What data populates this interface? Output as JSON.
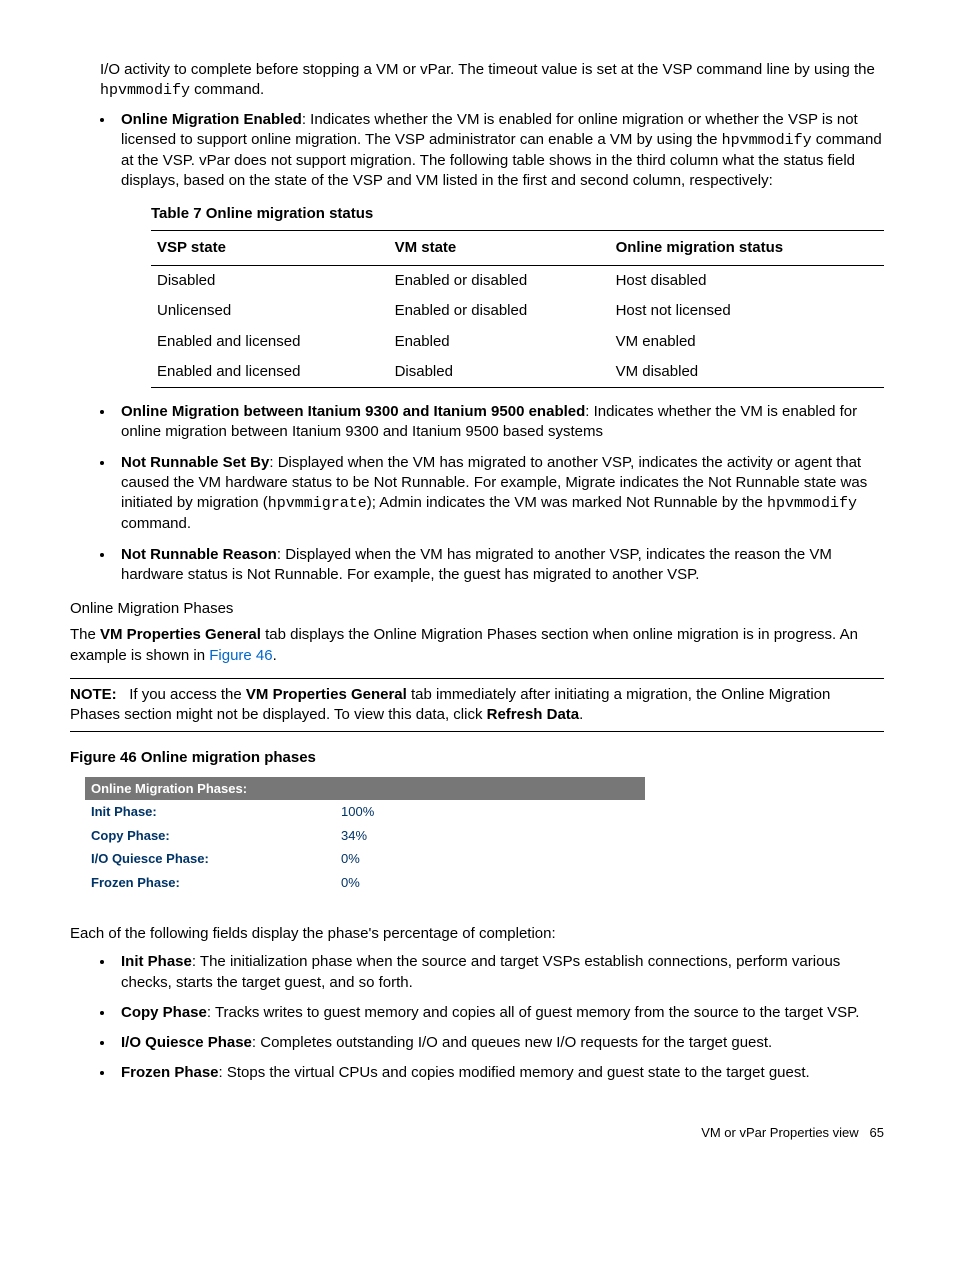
{
  "intro_para": {
    "line1_a": "I/O activity to complete before stopping a VM or vPar. The timeout value is set at the VSP command line by using the ",
    "cmd1": "hpvmmodify",
    "line1_b": " command."
  },
  "bullet_online_mig_enabled": {
    "label": "Online Migration Enabled",
    "text_a": ": Indicates whether the VM is enabled for online migration or whether the VSP is not licensed to support online migration. The VSP administrator can enable a VM by using the ",
    "cmd": "hpvmmodify",
    "text_b": " command at the VSP. vPar does not support migration. The following table shows in the third column what the status field displays, based on the state of the VSP and VM listed in the first and second column, respectively:"
  },
  "table7": {
    "title": "Table 7 Online migration status",
    "headers": [
      "VSP state",
      "VM state",
      "Online migration status"
    ],
    "rows": [
      [
        "Disabled",
        "Enabled or disabled",
        "Host disabled"
      ],
      [
        "Unlicensed",
        "Enabled or disabled",
        "Host not licensed"
      ],
      [
        "Enabled and licensed",
        "Enabled",
        "VM enabled"
      ],
      [
        "Enabled and licensed",
        "Disabled",
        "VM disabled"
      ]
    ]
  },
  "bullet_itanium": {
    "label": "Online Migration between Itanium 9300 and Itanium 9500 enabled",
    "text": ": Indicates whether the VM is enabled for online migration between Itanium 9300 and Itanium 9500 based systems"
  },
  "bullet_not_runnable_setby": {
    "label": "Not Runnable Set By",
    "text_a": ": Displayed when the VM has migrated to another VSP, indicates the activity or agent that caused the VM hardware status to be Not Runnable. For example, Migrate indicates the Not Runnable state was initiated by migration (",
    "cmd1": "hpvmmigrate",
    "text_b": "); Admin indicates the VM was marked Not Runnable by the ",
    "cmd2": "hpvmmodify",
    "text_c": " command."
  },
  "bullet_not_runnable_reason": {
    "label": "Not Runnable Reason",
    "text": ": Displayed when the VM has migrated to another VSP, indicates the reason the VM hardware status is Not Runnable. For example, the guest has migrated to another VSP."
  },
  "phases_heading": "Online Migration Phases",
  "phases_para": {
    "a": "The ",
    "b": "VM Properties General",
    "c": " tab displays the Online Migration Phases section when online migration is in progress. An example is shown in ",
    "link": "Figure 46",
    "d": "."
  },
  "note": {
    "prefix": "NOTE:",
    "a": "If you access the ",
    "b": "VM Properties General",
    "c": " tab immediately after initiating a migration, the Online Migration Phases section might not be displayed. To view this data, click ",
    "d": "Refresh Data",
    "e": "."
  },
  "figure46": {
    "title": "Figure 46 Online migration phases",
    "header": "Online Migration Phases:",
    "rows": [
      {
        "label": "Init Phase:",
        "value": "100%"
      },
      {
        "label": "Copy Phase:",
        "value": "34%"
      },
      {
        "label": "I/O Quiesce Phase:",
        "value": "0%"
      },
      {
        "label": "Frozen Phase:",
        "value": "0%"
      }
    ]
  },
  "fields_intro": "Each of the following fields display the phase's percentage of completion:",
  "phase_bullets": {
    "init": {
      "label": "Init Phase",
      "text": ": The initialization phase when the source and target VSPs establish connections, perform various checks, starts the target guest, and so forth."
    },
    "copy": {
      "label": "Copy Phase",
      "text": ": Tracks writes to guest memory and copies all of guest memory from the source to the target VSP."
    },
    "ioq": {
      "label": "I/O Quiesce Phase",
      "text": ": Completes outstanding I/O and queues new I/O requests for the target guest."
    },
    "frozen": {
      "label": "Frozen Phase",
      "text": ": Stops the virtual CPUs and copies modified memory and guest state to the target guest."
    }
  },
  "footer": {
    "text": "VM or vPar Properties view",
    "page": "65"
  }
}
